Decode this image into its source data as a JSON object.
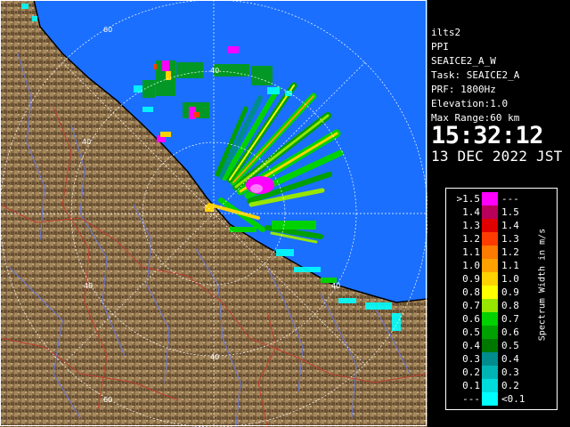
{
  "station": {
    "name": "ilts2",
    "product": "PPI",
    "scan": "SEAICE2_A_W",
    "task": "Task: SEAICE2_A",
    "prf": "PRF: 1800Hz",
    "elevation": "Elevation:1.0",
    "max_range": "Max Range:60 km",
    "time": "15:32:12",
    "date": "13 DEC 2022 JST"
  },
  "range_ring_labels": [
    "60",
    "40",
    "40",
    "40",
    "40",
    "40",
    "60"
  ],
  "legend": {
    "title": "Spectrum Width in m/s",
    "rows": [
      {
        "left": ">1.5",
        "right": "---",
        "color": "#ff00ff"
      },
      {
        "left": "1.4",
        "right": "1.5",
        "color": "#b8005a"
      },
      {
        "left": "1.3",
        "right": "1.4",
        "color": "#e00000"
      },
      {
        "left": "1.2",
        "right": "1.3",
        "color": "#ff3c00"
      },
      {
        "left": "1.1",
        "right": "1.2",
        "color": "#ff7a00"
      },
      {
        "left": "1.0",
        "right": "1.1",
        "color": "#ffa200"
      },
      {
        "left": "0.9",
        "right": "1.0",
        "color": "#ffd200"
      },
      {
        "left": "0.8",
        "right": "0.9",
        "color": "#ffff00"
      },
      {
        "left": "0.7",
        "right": "0.8",
        "color": "#96e600"
      },
      {
        "left": "0.6",
        "right": "0.7",
        "color": "#00d200"
      },
      {
        "left": "0.5",
        "right": "0.6",
        "color": "#00a000"
      },
      {
        "left": "0.4",
        "right": "0.5",
        "color": "#007800"
      },
      {
        "left": "0.3",
        "right": "0.4",
        "color": "#008c8c"
      },
      {
        "left": "0.2",
        "right": "0.3",
        "color": "#00b4b4"
      },
      {
        "left": "0.1",
        "right": "0.2",
        "color": "#00dcdc"
      },
      {
        "left": "---",
        "right": "<0.1",
        "color": "#00ffff"
      }
    ]
  },
  "colors": {
    "sea": "#1a6fff",
    "land": "#8a6e48",
    "river": "#6a78d8",
    "boundary": "#c04030",
    "rings": "#ffffff"
  }
}
